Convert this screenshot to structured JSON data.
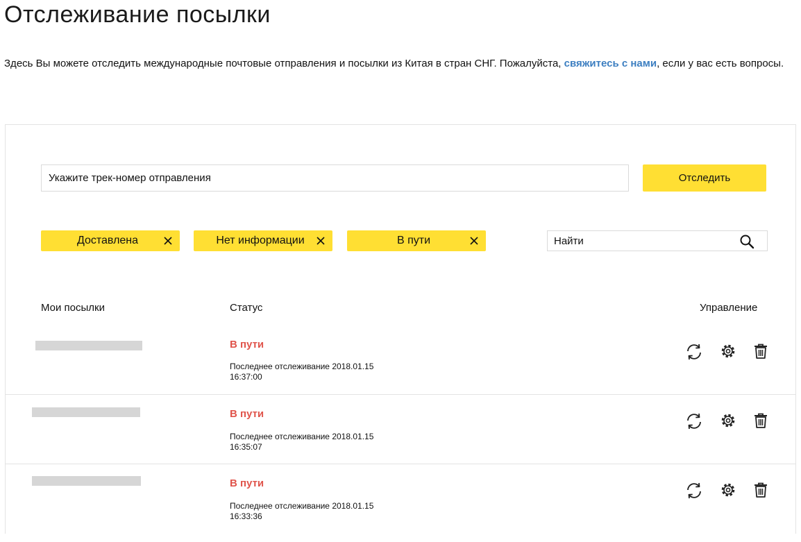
{
  "page": {
    "title": "Отслеживание посылки",
    "intro_before": "Здесь Вы можете отследить международные почтовые отправления и посылки из Китая в стран СНГ. Пожалуйста, ",
    "intro_link": "свяжитесь с нами",
    "intro_after": ", если у вас есть вопросы."
  },
  "tracker": {
    "input_placeholder": "Укажите трек-номер отправления",
    "button_label": "Отследить"
  },
  "filters": [
    {
      "label": "Доставлена"
    },
    {
      "label": "Нет информации"
    },
    {
      "label": "В пути"
    }
  ],
  "search": {
    "placeholder": "Найти"
  },
  "table": {
    "headers": {
      "parcels": "Мои посылки",
      "status": "Статус",
      "actions": "Управление"
    },
    "rows": [
      {
        "status": "В пути",
        "last_label": "Последнее отслеживание 2018.01.15",
        "last_time": "16:37:00"
      },
      {
        "status": "В пути",
        "last_label": "Последнее отслеживание 2018.01.15",
        "last_time": "16:35:07"
      },
      {
        "status": "В пути",
        "last_label": "Последнее отслеживание 2018.01.15",
        "last_time": "16:33:36"
      }
    ]
  },
  "colors": {
    "accent_yellow": "#ffdf33",
    "status_red": "#e0544b",
    "link_blue": "#3d7fc1"
  },
  "icons": [
    "close-icon",
    "search-icon",
    "refresh-icon",
    "gear-icon",
    "trash-icon"
  ]
}
